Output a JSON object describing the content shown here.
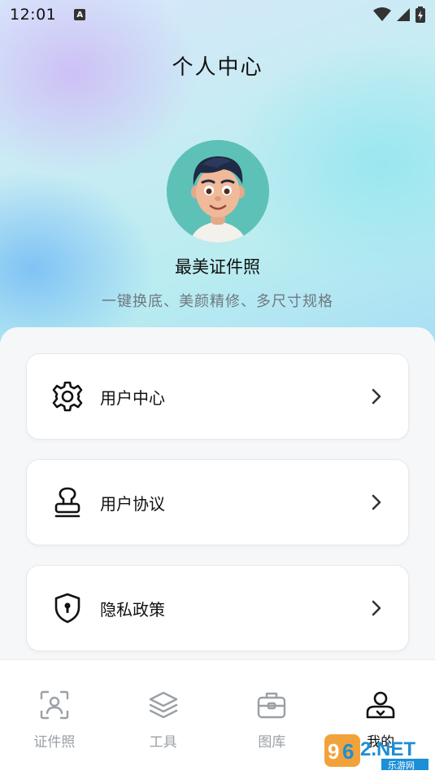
{
  "status_bar": {
    "time": "12:01",
    "notification_icon": "text-a-icon"
  },
  "header": {
    "title": "个人中心"
  },
  "profile": {
    "app_name": "最美证件照",
    "description": "一键换底、美颜精修、多尺寸规格"
  },
  "menu": [
    {
      "label": "用户中心",
      "icon": "gear-icon"
    },
    {
      "label": "用户协议",
      "icon": "stamp-icon"
    },
    {
      "label": "隐私政策",
      "icon": "shield-lock-icon"
    }
  ],
  "tabs": [
    {
      "label": "证件照",
      "icon": "id-photo-icon",
      "active": false
    },
    {
      "label": "工具",
      "icon": "layers-icon",
      "active": false
    },
    {
      "label": "图库",
      "icon": "toolbox-icon",
      "active": false
    },
    {
      "label": "我的",
      "icon": "profile-icon",
      "active": true
    }
  ],
  "watermark": {
    "text": "962.NET",
    "sub": "乐游网"
  },
  "colors": {
    "accent_text": "#111111",
    "inactive_tab": "#9aa0a6",
    "avatar_bg": "#5ec1b8"
  }
}
